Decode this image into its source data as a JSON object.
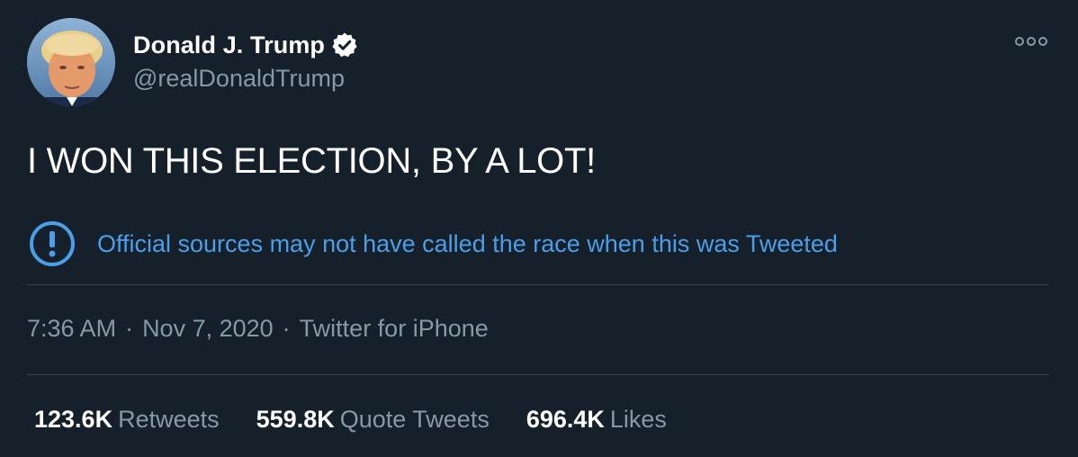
{
  "author": {
    "display_name": "Donald J. Trump",
    "handle": "@realDonaldTrump",
    "verified": true
  },
  "icons": {
    "verified": "verified-badge-icon",
    "more": "more-options-icon",
    "notice": "exclamation-circle-icon"
  },
  "tweet": {
    "text": "I WON THIS ELECTION, BY A LOT!",
    "notice": "Official sources may not have called the race when this was Tweeted"
  },
  "meta": {
    "time": "7:36 AM",
    "date": "Nov 7, 2020",
    "source": "Twitter for iPhone",
    "separator": "·"
  },
  "stats": [
    {
      "count": "123.6K",
      "label": "Retweets"
    },
    {
      "count": "559.8K",
      "label": "Quote Tweets"
    },
    {
      "count": "696.4K",
      "label": "Likes"
    }
  ],
  "colors": {
    "background": "#15202b",
    "secondary_text": "#8899a6",
    "notice_blue": "#4a9fe8",
    "divider": "#38444d"
  }
}
